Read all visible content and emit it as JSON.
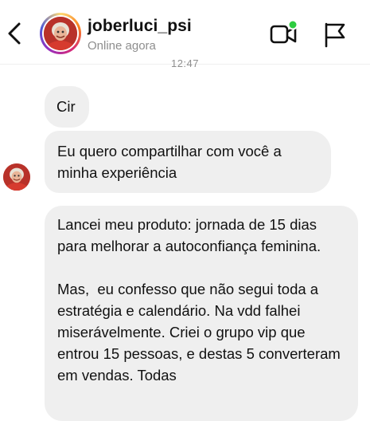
{
  "header": {
    "username": "joberluci_psi",
    "status": "Online agora"
  },
  "conversation": {
    "timestamp": "12:47",
    "messages": [
      {
        "text": "Cir"
      },
      {
        "text": "Eu quero compartilhar com você a minha experiência"
      },
      {
        "paragraphs": [
          "Lancei meu produto: jornada de 15 dias para melhorar a autoconfiança feminina.",
          "Mas,  eu confesso que não segui toda a estratégia e calendário. Na vdd falhei miserávelmente. Criei o grupo vip que entrou 15 pessoas, e destas 5 converteram em vendas. Todas"
        ]
      }
    ]
  },
  "colors": {
    "bubble": "#efefef",
    "online_dot": "#2ecc40",
    "muted_text": "#8e8e8e"
  },
  "icons": [
    "back-chevron-icon",
    "video-call-icon",
    "flag-icon"
  ]
}
